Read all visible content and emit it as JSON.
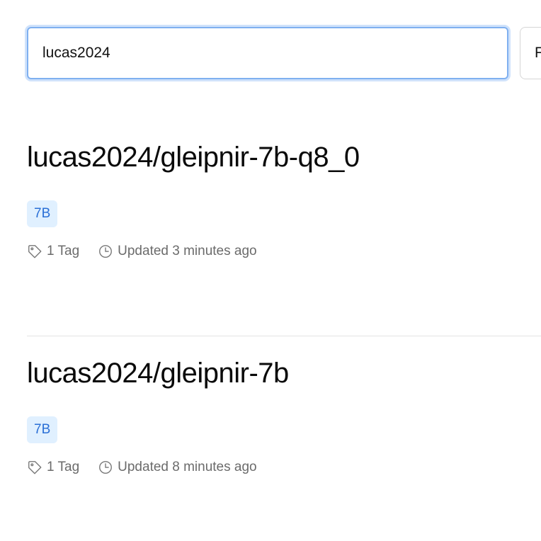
{
  "search": {
    "value": "lucas2024",
    "filter_label": "Filter"
  },
  "models": [
    {
      "name": "lucas2024/gleipnir-7b-q8_0",
      "size": "7B",
      "tags": "1 Tag",
      "updated": "Updated 3 minutes ago"
    },
    {
      "name": "lucas2024/gleipnir-7b",
      "size": "7B",
      "tags": "1 Tag",
      "updated": "Updated 8 minutes ago"
    }
  ],
  "icons": {
    "tag": "tag-icon",
    "clock": "clock-icon"
  },
  "colors": {
    "focus_border": "#7fb0f0",
    "badge_bg": "#e0f0ff",
    "badge_text": "#2a6fd6",
    "meta_text": "#6b6b6b"
  }
}
